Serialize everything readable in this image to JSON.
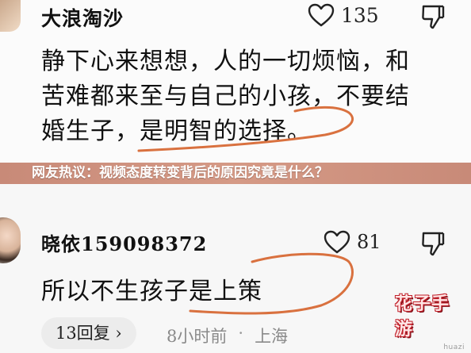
{
  "banner": {
    "text": "网友热议：视频态度转变背后的原因究竟是什么？"
  },
  "comments": [
    {
      "username": "大浪淘沙",
      "likes": "135",
      "lines": [
        "静下心来想想，人的一切烦恼，和",
        "苦难都来至与自己的小孩，不要结",
        "婚生子，是明智的选择。"
      ]
    },
    {
      "username": "晓依159098372",
      "likes": "81",
      "text": "所以不生孩子是上策",
      "reply_label": "13回复",
      "time": "8小时前",
      "location": "上海"
    }
  ],
  "icons": {
    "like": "heart-icon",
    "dislike": "thumbs-down-icon",
    "reply_arrow": "chevron-right-icon"
  },
  "colors": {
    "banner": "#d09482",
    "annotation": "#d9713f",
    "watermark": "#c0202a"
  },
  "watermark": {
    "title": "花子手游",
    "subtitle": "huazi"
  }
}
